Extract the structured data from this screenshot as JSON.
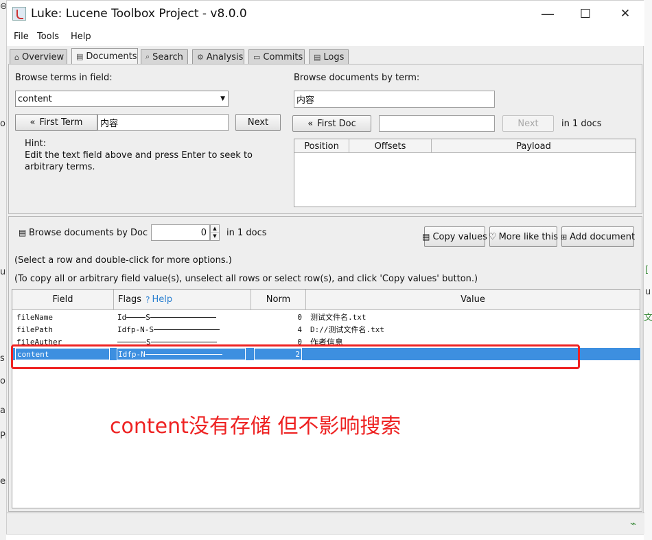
{
  "window": {
    "title": "Luke: Lucene Toolbox Project - v8.0.0",
    "minimize_glyph": "—",
    "maximize_glyph": "☐",
    "close_glyph": "✕"
  },
  "menu": [
    "File",
    "Tools",
    "Help"
  ],
  "tabs": [
    {
      "label": "Overview",
      "icon": "home-icon",
      "glyph": "⌂"
    },
    {
      "label": "Documents",
      "icon": "document-icon",
      "glyph": "▤"
    },
    {
      "label": "Search",
      "icon": "search-icon",
      "glyph": "⌕"
    },
    {
      "label": "Analysis",
      "icon": "analysis-icon",
      "glyph": "⚙"
    },
    {
      "label": "Commits",
      "icon": "commits-icon",
      "glyph": "▭"
    },
    {
      "label": "Logs",
      "icon": "logs-icon",
      "glyph": "▤"
    }
  ],
  "terms": {
    "heading": "Browse terms in field:",
    "field_value": "content",
    "first_term_label": "First Term",
    "first_term_glyph": "«",
    "term_value": "内容",
    "next_label": "Next",
    "hint_title": "Hint:",
    "hint_line1": "Edit the text field above and press Enter to seek to",
    "hint_line2": "arbitrary terms."
  },
  "docs_by_term": {
    "heading": "Browse documents by term:",
    "term_value": "内容",
    "first_doc_label": "First Doc",
    "first_doc_glyph": "«",
    "doc_value": "",
    "next_label": "Next",
    "count_text": "in 1 docs",
    "columns": [
      "Position",
      "Offsets",
      "Payload"
    ]
  },
  "doc_browser": {
    "label": "Browse documents by Doc #",
    "doc_number": "0",
    "count_text": "in 1 docs",
    "copy_values_label": "Copy values",
    "more_like_this_label": "More like this",
    "add_document_label": "Add document",
    "instruction1": "(Select a row and double-click for more options.)",
    "instruction2": "(To copy all or arbitrary field value(s), unselect all rows or select row(s), and click 'Copy values' button.)"
  },
  "fields_table": {
    "columns": {
      "field": "Field",
      "flags": "Flags",
      "help": "Help",
      "norm": "Norm",
      "value": "Value"
    },
    "rows": [
      {
        "field": "fileName",
        "flags_prefix": "Id",
        "flags_mid": "S",
        "norm": "0",
        "value": "测试文件名.txt",
        "selected": false
      },
      {
        "field": "filePath",
        "flags_prefix": "Idfp-N-",
        "flags_mid": "S",
        "norm": "4",
        "value": "D://测试文件名.txt",
        "selected": false
      },
      {
        "field": "fileAuther",
        "flags_prefix": "",
        "flags_mid": "S",
        "norm": "0",
        "value": "作者信息",
        "selected": false
      },
      {
        "field": "content",
        "flags_prefix": "Idfp-N",
        "flags_mid": "",
        "norm": "2",
        "value": "",
        "selected": true
      }
    ]
  },
  "annotation": {
    "text": "content没有存储 但不影响搜索",
    "color": "#ee2222"
  },
  "colors": {
    "selection": "#3d8fe0",
    "annotation": "#ee2222",
    "window_bg": "#eeeeee"
  },
  "background_glyphs": [
    "⊖",
    "o",
    "ur",
    "s",
    "o",
    "a",
    "Pr",
    "es",
    "[",
    "u",
    "文"
  ]
}
